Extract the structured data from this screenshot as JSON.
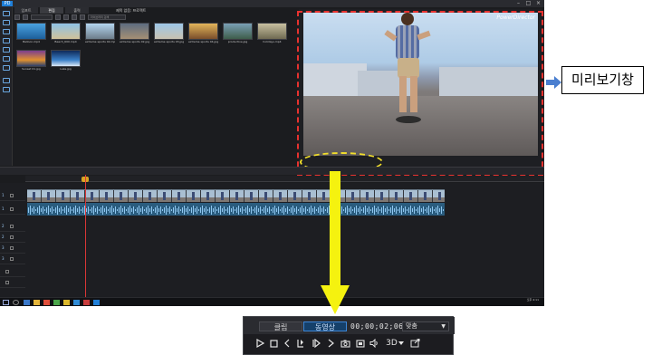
{
  "app": {
    "logo_text": "PD",
    "lib_tabs": [
      "임포트",
      "편집",
      "출력"
    ],
    "project_title": "제목 없음: 프로젝트",
    "search_placeholder": "라이브러리 검색",
    "brand": "PowerDirector"
  },
  "library": {
    "items": [
      {
        "label": "Balloon.mp4"
      },
      {
        "label": "Beach_600.mp4"
      },
      {
        "label": "extreme sports 02.mp4"
      },
      {
        "label": "extreme sports 02.jpg"
      },
      {
        "label": "extreme sports 03.jpg"
      },
      {
        "label": "extreme sports 04.jpg"
      },
      {
        "label": "productive.jpg"
      },
      {
        "label": "holidays.mp4"
      },
      {
        "label": "Family moment.mp4"
      },
      {
        "label": "Sunset 01.jpg"
      },
      {
        "label": "Lake.jpg"
      }
    ]
  },
  "taskbar": {
    "time": "오후 4:11",
    "date": "2018-03-21"
  },
  "callout": {
    "label": "미리보기창"
  },
  "zoom_controls": {
    "clip_tab": "클립",
    "movie_tab": "동영상",
    "timecode": "00;00;02;06",
    "fit_label": "맞춤",
    "three_d": "3D"
  },
  "colors": {
    "highlight_box": "#e8322f",
    "ellipse": "#f2df2b",
    "callout_arrow": "#4a7fd0",
    "big_arrow": "#f5f20f",
    "accent": "#1f7fd8"
  },
  "icons": [
    "play-icon",
    "stop-icon",
    "prev-frame-icon",
    "capture-icon",
    "next-frame-icon",
    "skip-icon",
    "snapshot-icon",
    "subtitle-icon",
    "volume-icon",
    "3d-icon",
    "undock-icon"
  ]
}
